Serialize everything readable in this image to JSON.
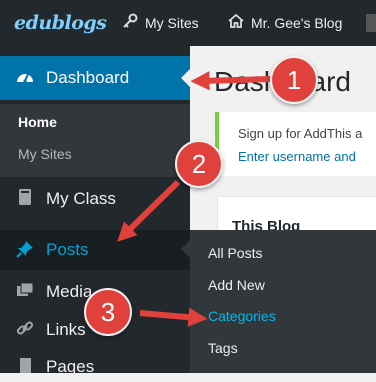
{
  "adminbar": {
    "logo": "edublogs",
    "my_sites": "My Sites",
    "blog_name": "Mr. Gee's Blog"
  },
  "sidebar": {
    "dashboard": "Dashboard",
    "sub_home": "Home",
    "sub_my_sites": "My Sites",
    "my_class": "My Class",
    "posts": "Posts",
    "media": "Media",
    "links": "Links",
    "pages": "Pages"
  },
  "flyout": {
    "items": [
      "All Posts",
      "Add New",
      "Categories",
      "Tags"
    ]
  },
  "content": {
    "title": "Dashboard",
    "notice_line1": "Sign up for AddThis a",
    "notice_line2": "Enter username and",
    "panel_title": "This Blog"
  },
  "annotations": {
    "step1": "1",
    "step2": "2",
    "step3": "3"
  },
  "colors": {
    "accent": "#0073aa",
    "annotation": "#e0413c",
    "notice_border": "#7ad03a"
  }
}
